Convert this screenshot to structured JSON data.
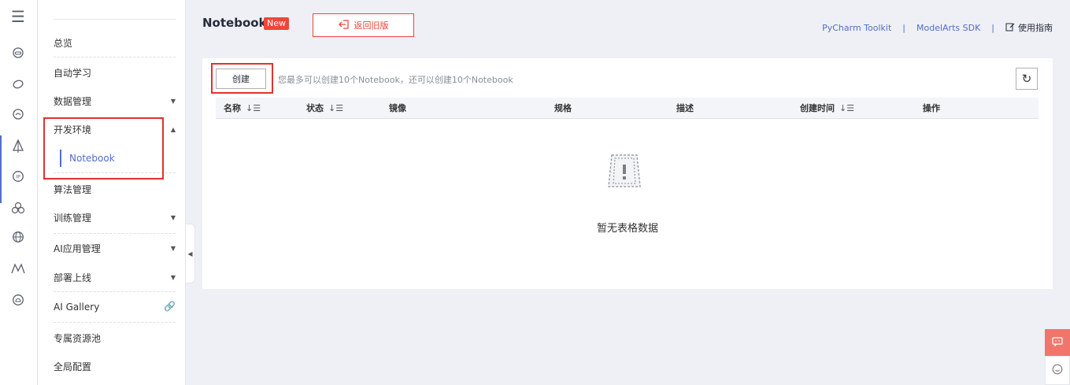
{
  "header": {
    "title": "Notebook",
    "new_badge": "New",
    "back_old_label": "返回旧版",
    "links": {
      "pycharm": "PyCharm Toolkit",
      "sep1": "|",
      "sdk": "ModelArts SDK",
      "sep2": "|",
      "guide": "使用指南"
    }
  },
  "sidebar": {
    "items": [
      {
        "label": "总览"
      },
      {
        "label": "自动学习"
      },
      {
        "label": "数据管理"
      },
      {
        "label": "开发环境"
      },
      {
        "label": "Notebook"
      },
      {
        "label": "算法管理"
      },
      {
        "label": "训练管理"
      },
      {
        "label": "AI应用管理"
      },
      {
        "label": "部署上线"
      },
      {
        "label": "AI Gallery"
      },
      {
        "label": "专属资源池"
      },
      {
        "label": "全局配置"
      }
    ],
    "active_item": "Notebook"
  },
  "toolbar": {
    "create_label": "创建",
    "hint": "您最多可以创建10个Notebook，还可以创建10个Notebook"
  },
  "table": {
    "columns": [
      "名称",
      "状态",
      "镜像",
      "规格",
      "描述",
      "创建时间",
      "操作"
    ],
    "empty_text": "暂无表格数据"
  },
  "colors": {
    "accent": "#526ecc",
    "danger": "#f0453a",
    "highlight_box": "#e0332d"
  }
}
